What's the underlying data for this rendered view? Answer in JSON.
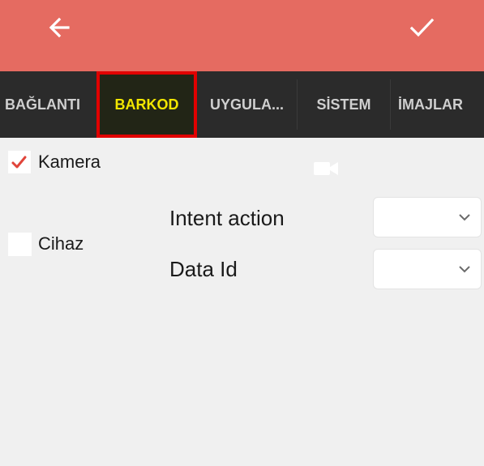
{
  "appbar": {
    "back_icon": "arrow-left-icon",
    "confirm_icon": "checkmark-icon",
    "color": "#e56b61"
  },
  "tabs": [
    {
      "label": "BAĞLANTI"
    },
    {
      "label": "BARKOD",
      "active": true
    },
    {
      "label": "UYGULA..."
    },
    {
      "label": "SİSTEM"
    },
    {
      "label": "İMAJLAR"
    }
  ],
  "options": {
    "camera": {
      "label": "Kamera",
      "checked": true,
      "icon": "video-camera-icon"
    },
    "device": {
      "label": "Cihaz",
      "checked": false
    }
  },
  "fields": {
    "intent_action": {
      "label": "Intent action",
      "value": ""
    },
    "data_id": {
      "label": "Data Id",
      "value": ""
    }
  },
  "colors": {
    "accent": "#e56b61",
    "tab_bar": "#2b2b2b",
    "active_tab_text": "#f2e600",
    "highlight_border": "#e10000",
    "check": "#e0443a"
  }
}
